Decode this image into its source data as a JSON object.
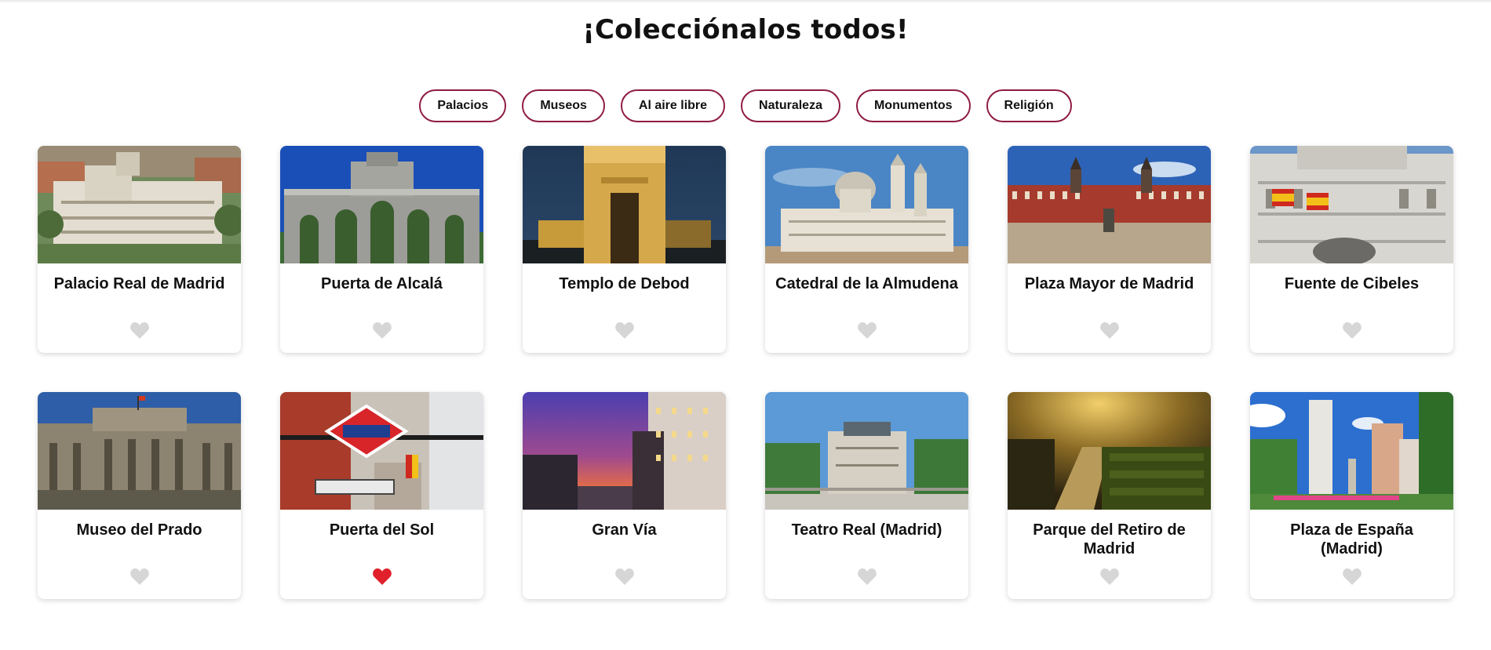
{
  "page": {
    "title": "¡Colecciónalos todos!"
  },
  "filters": [
    {
      "label": "Palacios"
    },
    {
      "label": "Museos"
    },
    {
      "label": "Al aire libre"
    },
    {
      "label": "Naturaleza"
    },
    {
      "label": "Monumentos"
    },
    {
      "label": "Religión"
    }
  ],
  "cards": [
    {
      "title": "Palacio Real de Madrid",
      "favorite": false,
      "image": "aerial palace"
    },
    {
      "title": "Puerta de Alcalá",
      "favorite": false,
      "image": "stone gate, blue sky"
    },
    {
      "title": "Templo de Debod",
      "favorite": false,
      "image": "illuminated temple at dusk"
    },
    {
      "title": "Catedral de la Almudena",
      "favorite": false,
      "image": "cathedral, blue sky"
    },
    {
      "title": "Plaza Mayor de Madrid",
      "favorite": false,
      "image": "red-facade square"
    },
    {
      "title": "Fuente de Cibeles",
      "favorite": false,
      "image": "white palace with flags"
    },
    {
      "title": "Museo del Prado",
      "favorite": false,
      "image": "museum facade"
    },
    {
      "title": "Puerta del Sol",
      "favorite": true,
      "image": "metro sign"
    },
    {
      "title": "Gran Vía",
      "favorite": false,
      "image": "avenue at sunset"
    },
    {
      "title": "Teatro Real (Madrid)",
      "favorite": false,
      "image": "theatre plaza"
    },
    {
      "title": "Parque del Retiro de Madrid",
      "favorite": false,
      "image": "park hedges, golden light"
    },
    {
      "title": "Plaza de España (Madrid)",
      "favorite": false,
      "image": "towers and trees"
    }
  ],
  "colors": {
    "accent": "#8f1b45",
    "heart_on": "#e0202a",
    "heart_off": "#d6d6d6"
  },
  "icons": {
    "favorite": "heart-icon"
  }
}
